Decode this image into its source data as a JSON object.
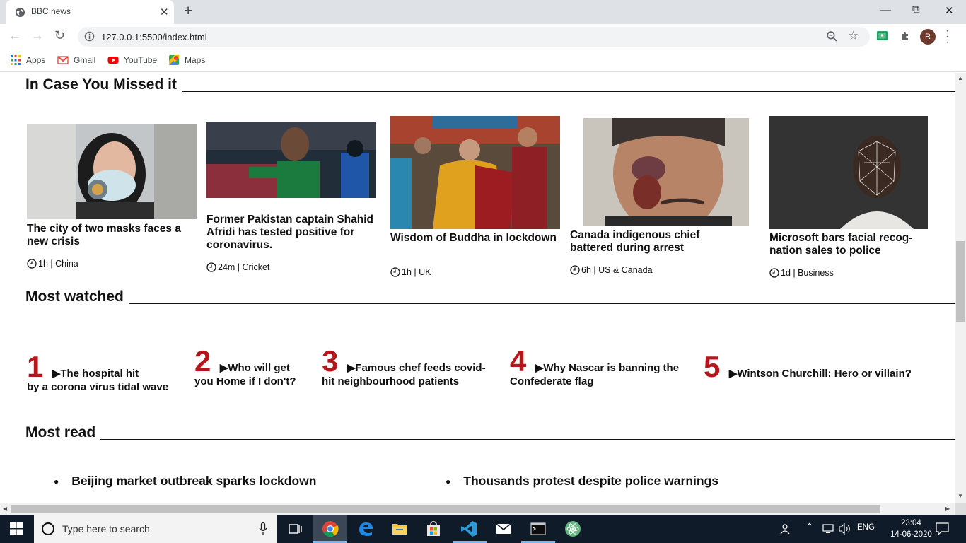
{
  "browser": {
    "tab_title": "BBC news",
    "url": "127.0.0.1:5500/index.html",
    "profile_initial": "R",
    "bookmarks": [
      "Apps",
      "Gmail",
      "YouTube",
      "Maps"
    ]
  },
  "sections": {
    "missed": "In Case You Missed it",
    "watched": "Most watched",
    "read": "Most read"
  },
  "missed_cards": [
    {
      "headline": "The city of two masks faces a new crisis",
      "meta": "1h | China",
      "image": "woman-wearing-respirator"
    },
    {
      "headline": "Former Pakistan captain Shahid Afridi has tested positive for coronavirus.",
      "meta": "24m | Cricket",
      "image": "cricket-player"
    },
    {
      "headline": "Wisdom of Buddha in lockdown",
      "meta": "1h | UK",
      "image": "dalai-lama-with-monks"
    },
    {
      "headline": "Canada indigenous chief battered during arrest",
      "meta": "6h | US & Canada",
      "image": "injured-man-face"
    },
    {
      "headline": "Microsoft bars facial recog-nation sales to police",
      "meta": "1d | Business",
      "image": "facial-recognition-mesh"
    }
  ],
  "most_watched": [
    {
      "num": "1",
      "line1": "▶The hospital hit",
      "line2": "by a corona virus tidal wave"
    },
    {
      "num": "2",
      "line1": "▶Who will get",
      "line2": "you Home if I don't?"
    },
    {
      "num": "3",
      "line1": "▶Famous chef feeds covid-",
      "line2": "hit neighbourhood patients"
    },
    {
      "num": "4",
      "line1": "▶Why Nascar is banning the",
      "line2": "Confederate flag"
    },
    {
      "num": "5",
      "line1": "▶Wintson Churchill: Hero or villain?",
      "line2": ""
    }
  ],
  "most_read": [
    "Beijing market outbreak sparks lockdown",
    "Thousands protest despite police warnings"
  ],
  "taskbar": {
    "search_placeholder": "Type here to search",
    "language": "ENG",
    "time": "23:04",
    "date": "14-06-2020"
  },
  "colors": {
    "accent_red": "#b5161c",
    "taskbar": "#101b29",
    "tabstrip": "#dee1e6"
  }
}
